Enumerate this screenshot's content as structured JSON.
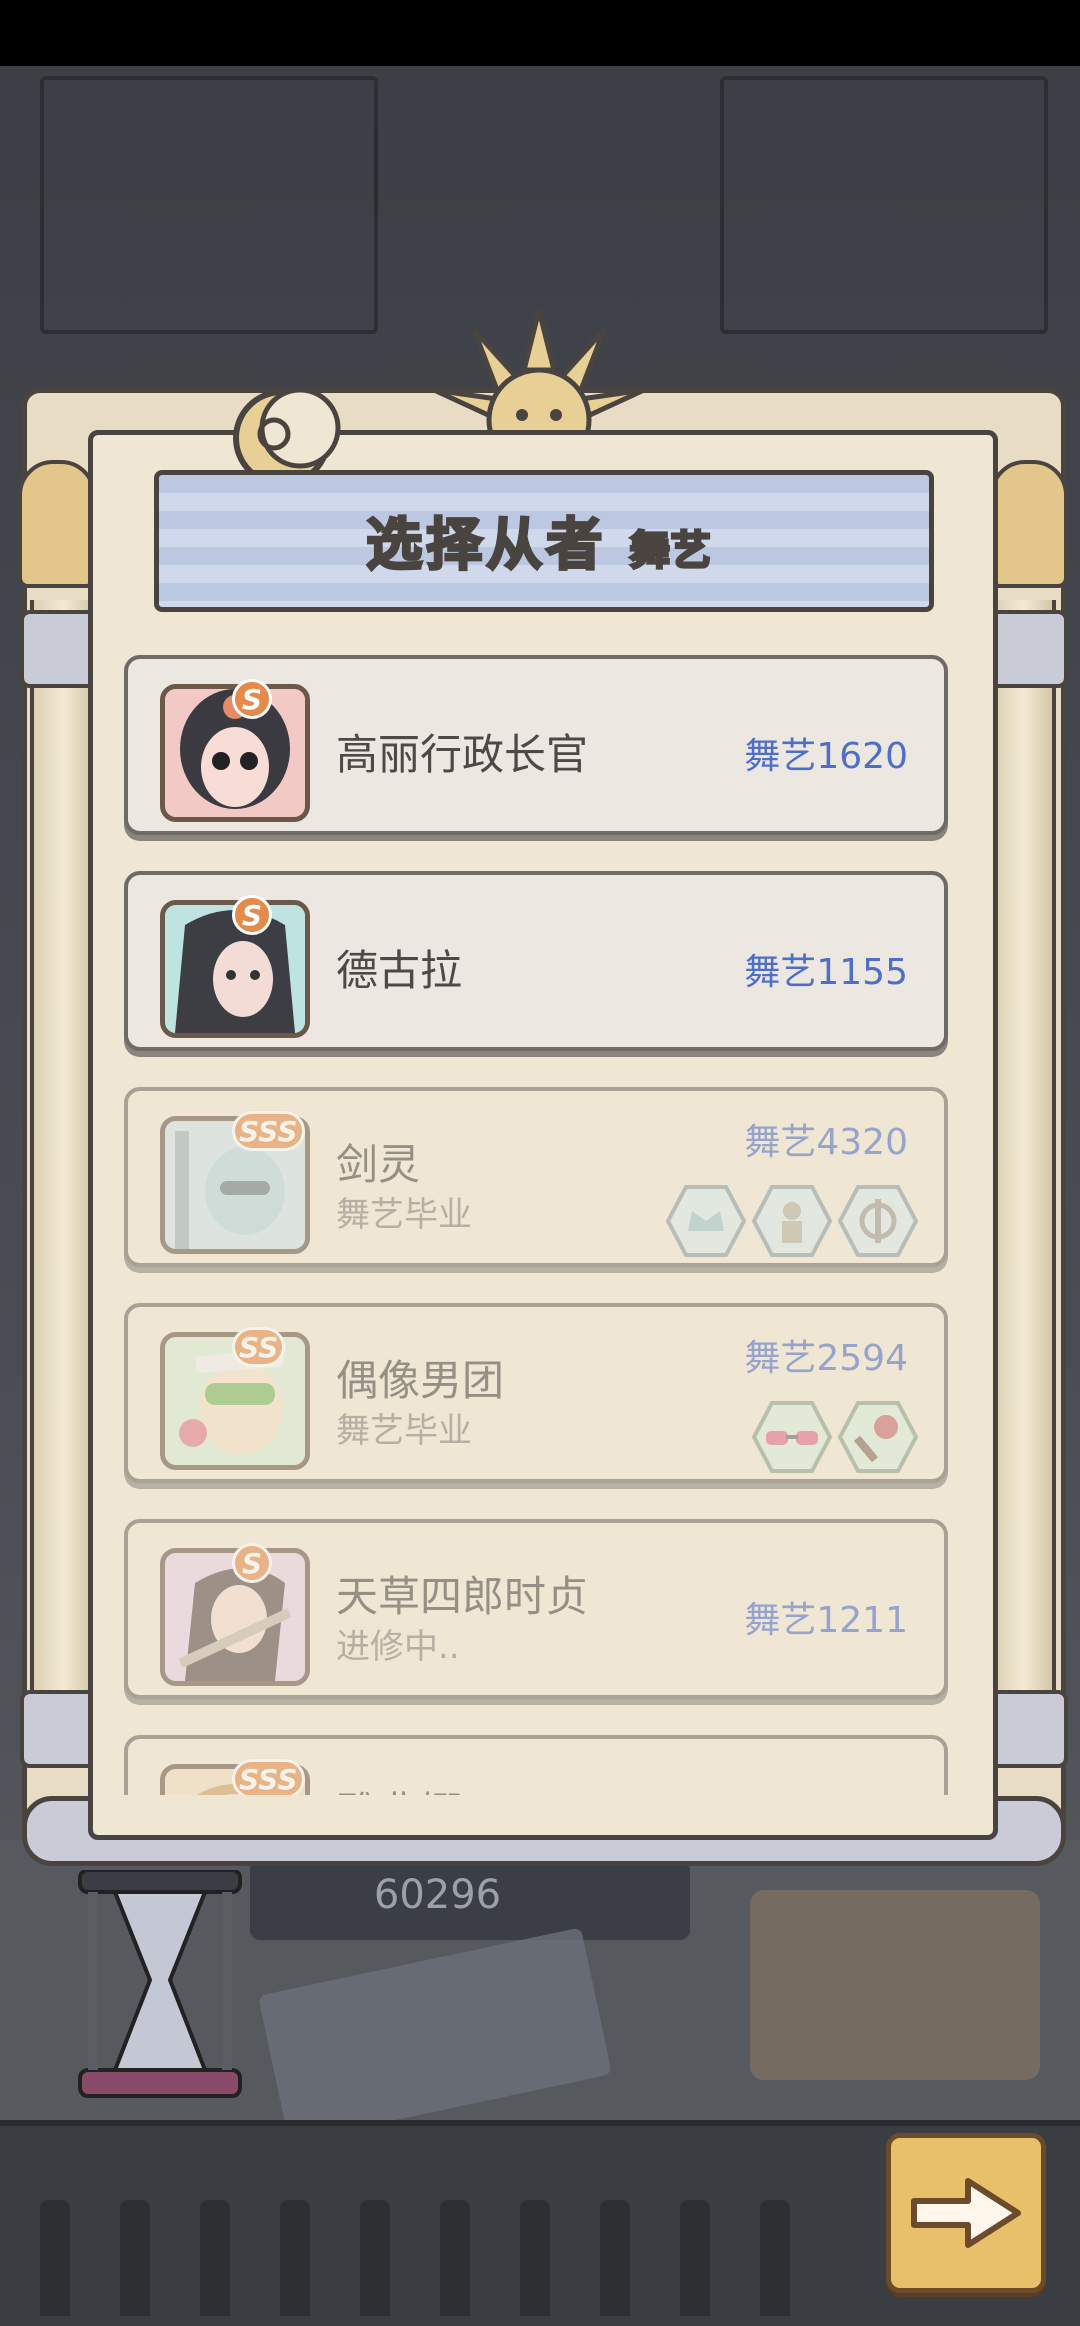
{
  "dialog": {
    "title": "选择从者",
    "subtitle": "舞艺"
  },
  "servants": [
    {
      "name": "高丽行政长官",
      "rank": "S",
      "stat": "舞艺1620",
      "status": "",
      "available": true,
      "relics": []
    },
    {
      "name": "德古拉",
      "rank": "S",
      "stat": "舞艺1155",
      "status": "",
      "available": true,
      "relics": []
    },
    {
      "name": "剑灵",
      "rank": "SSS",
      "stat": "舞艺4320",
      "status": "舞艺毕业",
      "available": false,
      "relics": [
        "crown-relic-icon",
        "figure-relic-icon",
        "altar-relic-icon"
      ]
    },
    {
      "name": "偶像男团",
      "rank": "SS",
      "stat": "舞艺2594",
      "status": "舞艺毕业",
      "available": false,
      "relics": [
        "sunglasses-relic-icon",
        "microphone-relic-icon"
      ]
    },
    {
      "name": "天草四郎时贞",
      "rank": "S",
      "stat": "舞艺1211",
      "status": "进修中..",
      "available": false,
      "relics": []
    },
    {
      "name": "雅典娜",
      "rank": "SSS",
      "stat": "",
      "status": "",
      "available": false,
      "relics": []
    }
  ],
  "background": {
    "score": "60296"
  },
  "colors": {
    "stat_blue": "#4f6fc7",
    "rank_orange": "#e48a4a",
    "panel_cream": "#efe6d3",
    "banner_blue": "#bcc8e2"
  }
}
